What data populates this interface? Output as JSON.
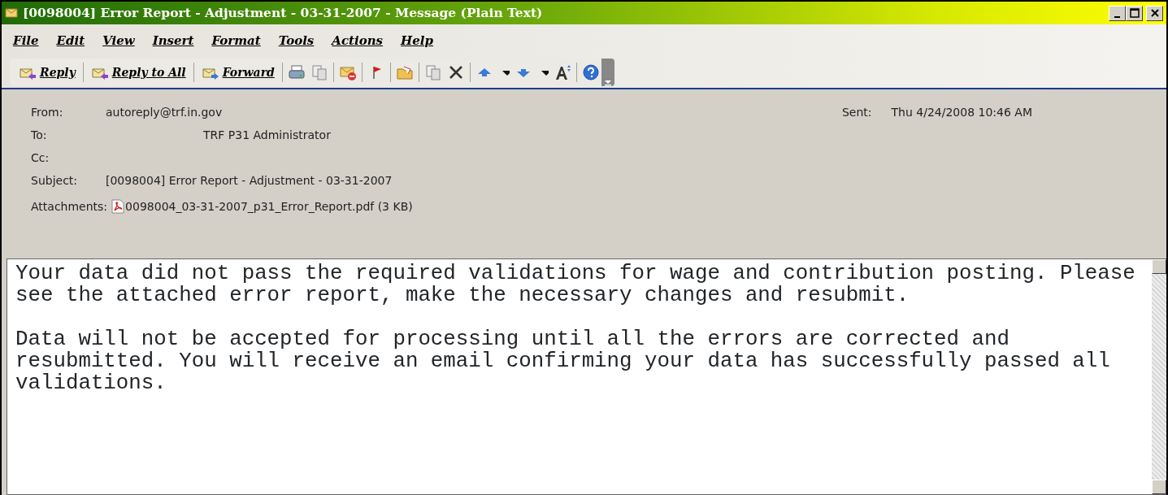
{
  "window": {
    "title": "[0098004] Error Report - Adjustment - 03-31-2007 - Message (Plain Text)"
  },
  "menu": [
    {
      "label": "File"
    },
    {
      "label": "Edit"
    },
    {
      "label": "View"
    },
    {
      "label": "Insert"
    },
    {
      "label": "Format"
    },
    {
      "label": "Tools"
    },
    {
      "label": "Actions"
    },
    {
      "label": "Help"
    }
  ],
  "toolbar": [
    {
      "label": "Reply"
    },
    {
      "label": "Reply to All"
    },
    {
      "label": "Forward"
    }
  ],
  "header": {
    "from_label": "From:",
    "from": "autoreply@trf.in.gov",
    "sent_label": "Sent:",
    "sent": "Thu 4/24/2008 10:46 AM",
    "to_label": "To:",
    "to": "TRF P31 Administrator",
    "cc_label": "Cc:",
    "subject_label": "Subject:",
    "subject": "[0098004] Error Report - Adjustment - 03-31-2007",
    "attachments_label": "Attachments:",
    "attachment": "0098004_03-31-2007_p31_Error_Report.pdf (3 KB)"
  },
  "body": [
    "Your data did not pass the required validations for wage and contribution posting. Please see the attached error report, make the necessary changes and resubmit.",
    "Data will not be accepted for processing until all the errors are corrected and resubmitted. You will receive an email confirming your data has successfully passed all validations."
  ]
}
